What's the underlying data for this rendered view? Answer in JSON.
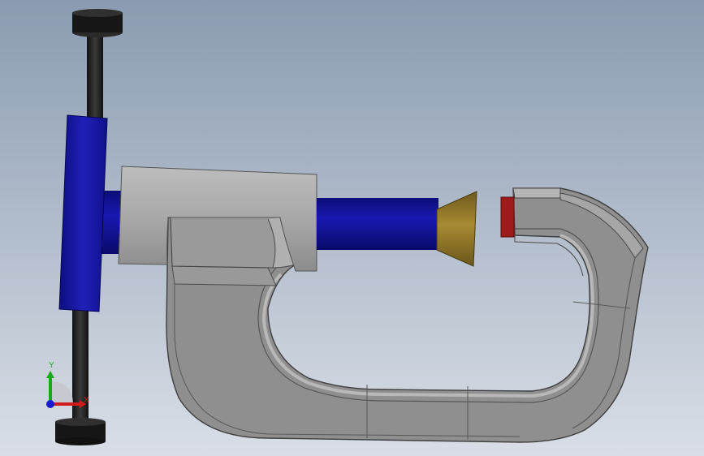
{
  "viewport": {
    "background_top": "#8a9bb1",
    "background_bottom": "#d9dee6"
  },
  "colors": {
    "frame_fill": "#8e8e8e",
    "frame_edge": "#4a4a4a",
    "frame_light": "#a9a9a9",
    "barrel_fill": "#a4a4a4",
    "spindle_fill": "#10109a",
    "thimble_fill": "#1a1aa6",
    "handle_fill": "#1c1c1c",
    "knob_fill": "#151515",
    "anvil_fill": "#9c1b1b",
    "tip_fill": "#8b7225",
    "axis_x": "#d11a1a",
    "axis_y": "#1aa81a",
    "axis_z": "#1a1ad1"
  },
  "triad": {
    "x_label": "X",
    "y_label": "Y",
    "x_icon": "axis-x-arrow",
    "y_icon": "axis-y-arrow",
    "z_icon": "axis-z-dot"
  }
}
